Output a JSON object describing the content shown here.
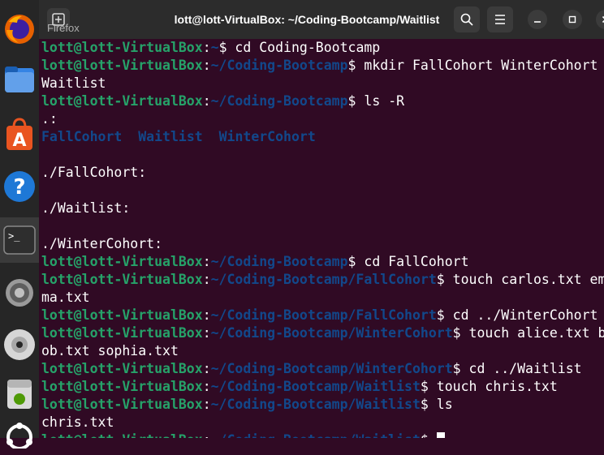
{
  "window": {
    "title": "lott@lott-VirtualBox: ~/Coding-Bootcamp/Waitlist",
    "tooltip": "Firefox"
  },
  "dock": {
    "items": [
      {
        "name": "firefox-icon"
      },
      {
        "name": "files-icon"
      },
      {
        "name": "app-center-icon"
      },
      {
        "name": "help-icon"
      },
      {
        "name": "terminal-icon"
      },
      {
        "name": "settings-icon"
      },
      {
        "name": "disc-icon"
      },
      {
        "name": "trash-icon"
      },
      {
        "name": "ubuntu-icon"
      }
    ]
  },
  "terminal": {
    "host": "lott@lott-VirtualBox",
    "lines": [
      {
        "type": "prompt",
        "path": "~",
        "cmd": " cd Coding-Bootcamp"
      },
      {
        "type": "prompt",
        "path": "~/Coding-Bootcamp",
        "cmd": " mkdir FallCohort WinterCohort"
      },
      {
        "type": "text",
        "text": "Waitlist"
      },
      {
        "type": "prompt",
        "path": "~/Coding-Bootcamp",
        "cmd": " ls -R"
      },
      {
        "type": "text",
        "text": ".:"
      },
      {
        "type": "dirs",
        "items": [
          "FallCohort",
          "Waitlist",
          "WinterCohort"
        ]
      },
      {
        "type": "text",
        "text": ""
      },
      {
        "type": "text",
        "text": "./FallCohort:"
      },
      {
        "type": "text",
        "text": ""
      },
      {
        "type": "text",
        "text": "./Waitlist:"
      },
      {
        "type": "text",
        "text": ""
      },
      {
        "type": "text",
        "text": "./WinterCohort:"
      },
      {
        "type": "prompt",
        "path": "~/Coding-Bootcamp",
        "cmd": " cd FallCohort"
      },
      {
        "type": "prompt",
        "path": "~/Coding-Bootcamp/FallCohort",
        "cmd": " touch carlos.txt em"
      },
      {
        "type": "text",
        "text": "ma.txt"
      },
      {
        "type": "prompt",
        "path": "~/Coding-Bootcamp/FallCohort",
        "cmd": " cd ../WinterCohort"
      },
      {
        "type": "prompt",
        "path": "~/Coding-Bootcamp/WinterCohort",
        "cmd": " touch alice.txt b"
      },
      {
        "type": "text",
        "text": "ob.txt sophia.txt"
      },
      {
        "type": "prompt",
        "path": "~/Coding-Bootcamp/WinterCohort",
        "cmd": " cd ../Waitlist"
      },
      {
        "type": "prompt",
        "path": "~/Coding-Bootcamp/Waitlist",
        "cmd": " touch chris.txt"
      },
      {
        "type": "prompt",
        "path": "~/Coding-Bootcamp/Waitlist",
        "cmd": " ls"
      },
      {
        "type": "text",
        "text": "chris.txt"
      },
      {
        "type": "prompt",
        "path": "~/Coding-Bootcamp/Waitlist",
        "cmd": " ",
        "cursor": true
      }
    ]
  },
  "colors": {
    "background": "#300a24",
    "user": "#26a269",
    "path": "#12488b",
    "titlebar": "#2c2c2c"
  }
}
